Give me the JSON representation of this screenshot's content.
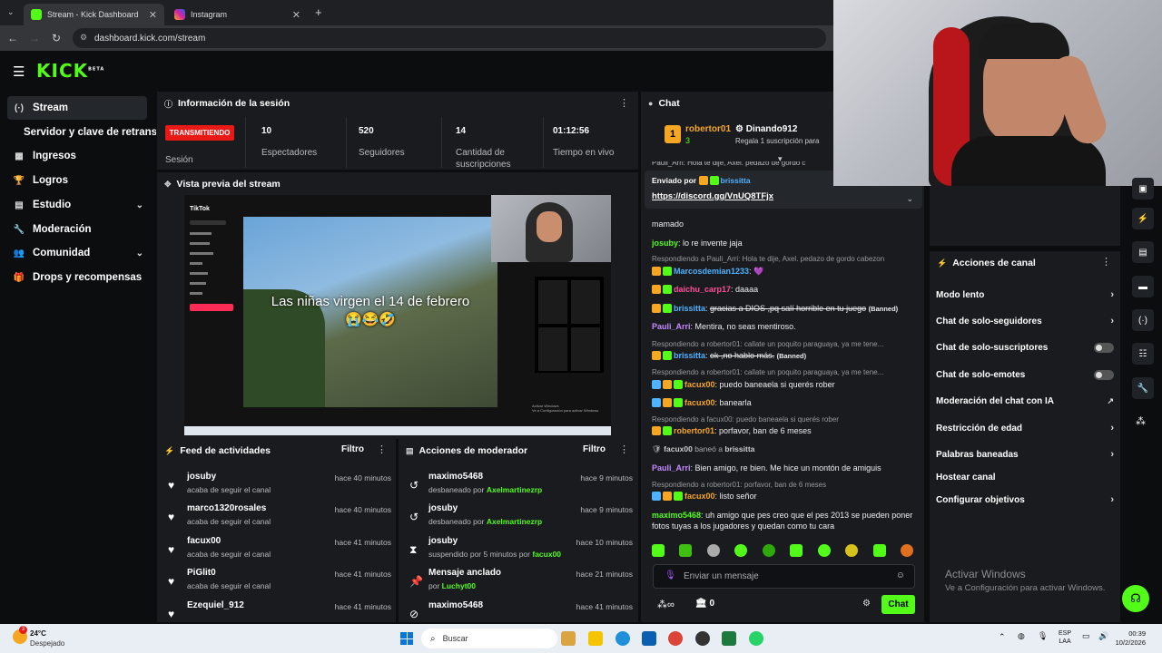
{
  "browser": {
    "tabs": [
      {
        "title": "Stream - Kick Dashboard"
      },
      {
        "title": "Instagram"
      }
    ],
    "url": "dashboard.kick.com/stream"
  },
  "logo": {
    "text": "KICK",
    "beta": "BETA"
  },
  "sidebar": {
    "items": [
      {
        "label": "Stream"
      },
      {
        "label": "Servidor y clave de retransm"
      },
      {
        "label": "Ingresos"
      },
      {
        "label": "Logros"
      },
      {
        "label": "Estudio"
      },
      {
        "label": "Moderación"
      },
      {
        "label": "Comunidad"
      },
      {
        "label": "Drops y recompensas"
      }
    ]
  },
  "session": {
    "title": "Información de la sesión",
    "live_badge": "TRANSMITIENDO",
    "live_label": "Sesión",
    "stats": [
      {
        "value": "10",
        "label": "Espectadores"
      },
      {
        "value": "520",
        "label": "Seguidores"
      },
      {
        "value": "14",
        "label": "Cantidad de suscripciones"
      },
      {
        "value": "01:12:56",
        "label": "Tiempo en vivo"
      }
    ]
  },
  "preview": {
    "title": "Vista previa del stream",
    "caption": "Las niñas virgen el 14 de febrero 😭😂🤣",
    "app_name": "TikTok",
    "watermark_1": "Activar Windows",
    "watermark_2": "Ve a Configuración para activar Windows."
  },
  "feed": {
    "title": "Feed de actividades",
    "filter": "Filtro",
    "items": [
      {
        "user": "josuby",
        "action": "acaba de seguir el canal",
        "time": "hace 40 minutos"
      },
      {
        "user": "marco1320rosales",
        "action": "acaba de seguir el canal",
        "time": "hace 40 minutos"
      },
      {
        "user": "facux00",
        "action": "acaba de seguir el canal",
        "time": "hace 41 minutos"
      },
      {
        "user": "PiGlit0",
        "action": "acaba de seguir el canal",
        "time": "hace 41 minutos"
      },
      {
        "user": "Ezequiel_912",
        "action": "",
        "time": "hace 41 minutos"
      }
    ]
  },
  "modactions": {
    "title": "Acciones de moderador",
    "filter": "Filtro",
    "items": [
      {
        "user": "maximo5468",
        "action": "desbaneado por",
        "by": "Axelmartinezrp",
        "time": "hace 9 minutos"
      },
      {
        "user": "josuby",
        "action": "desbaneado por",
        "by": "Axelmartinezrp",
        "time": "hace 9 minutos"
      },
      {
        "user": "josuby",
        "action": "suspendido por 5 minutos por",
        "by": "facux00",
        "time": "hace 10 minutos"
      },
      {
        "user": "Mensaje anclado",
        "action": "por",
        "by": "Luchyt00",
        "time": "hace 21 minutos"
      },
      {
        "user": "maximo5468",
        "action": "",
        "by": "",
        "time": "hace 41 minutos"
      }
    ]
  },
  "chat": {
    "title": "Chat",
    "top_gifter": {
      "name": "robertor01",
      "rank": "1",
      "count": "3"
    },
    "gifter2": {
      "name": "Dinando912",
      "note": "Regala 1 suscripción para"
    },
    "pinned_by_label": "Enviado por",
    "pinned_by": "brissitta",
    "pinned_link": "https://discord.gg/VnUQ8TFjx",
    "truncated_top": "Pauli_Arri: Hola te dije, Axel. pedazo de gordo c",
    "messages": [
      {
        "reply": "",
        "user": "",
        "text": "mamado"
      },
      {
        "reply": "",
        "user": "josuby",
        "text": "lo re invente jaja"
      },
      {
        "reply": "Respondiendo a Pauli_Arri: Hola te dije, Axel. pedazo de gordo cabezon",
        "user": "Marcosdemian1233",
        "text": "💜"
      },
      {
        "reply": "",
        "user": "daichu_carp17",
        "text": "daaaa"
      },
      {
        "reply": "",
        "user": "brissitta",
        "text": "gracias a DIOS ,pq salí horrible en tu juego",
        "tag": "(Banned)"
      },
      {
        "reply": "",
        "user": "Pauli_Arri",
        "text": "Mentira, no seas mentiroso."
      },
      {
        "reply": "Respondiendo a robertor01: callate un poquito paraguaya, ya me tene...",
        "user": "brissitta",
        "text": "ok ,no hablo más.",
        "tag": "(Banned)"
      },
      {
        "reply": "Respondiendo a robertor01: callate un poquito paraguaya, ya me tene...",
        "user": "facux00",
        "text": "puedo baneaela si querés rober"
      },
      {
        "reply": "",
        "user": "facux00",
        "text": "banearla"
      },
      {
        "reply": "Respondiendo a facux00: puedo baneaela si querés rober",
        "user": "robertor01",
        "text": "porfavor, ban de 6 meses"
      },
      {
        "reply": "",
        "user": "facux00",
        "text": "baneó a",
        "target": "brissitta"
      },
      {
        "reply": "",
        "user": "Pauli_Arri",
        "text": "Bien amigo, re bien. Me hice un montón de amiguis"
      },
      {
        "reply": "Respondiendo a robertor01: porfavor, ban de 6 meses",
        "user": "facux00",
        "text": "listo señor"
      },
      {
        "reply": "",
        "user": "maximo5468",
        "text": "uh amigo que pes creo que el pes 2013 se pueden poner fotos tuyas a los jugadores y quedan como tu cara"
      }
    ],
    "input_placeholder": "Enviar un mensaje",
    "points": "0",
    "send": "Chat"
  },
  "actions": {
    "title": "Acciones de canal",
    "items": [
      {
        "label": "Modo lento",
        "kind": "arrow"
      },
      {
        "label": "Chat de solo-seguidores",
        "kind": "arrow"
      },
      {
        "label": "Chat de solo-suscriptores",
        "kind": "toggle"
      },
      {
        "label": "Chat de solo-emotes",
        "kind": "toggle"
      },
      {
        "label": "Moderación del chat con IA",
        "kind": "external"
      },
      {
        "label": "Restricción de edad",
        "kind": "arrow"
      },
      {
        "label": "Palabras baneadas",
        "kind": "arrow"
      },
      {
        "label": "Hostear canal",
        "kind": "none"
      },
      {
        "label": "Configurar objetivos",
        "kind": "arrow"
      }
    ]
  },
  "watermark": {
    "line1": "Activar Windows",
    "line2": "Ve a Configuración para activar Windows."
  },
  "taskbar": {
    "weather_temp": "24°C",
    "weather_desc": "Despejado",
    "weather_badge": "3",
    "search": "Buscar",
    "lang1": "ESP",
    "lang2": "LAA",
    "time": "00:39",
    "date": "10/2/2026"
  },
  "colors": {
    "accent": "#53fc18",
    "live": "#e91916",
    "panel": "#191b1f"
  }
}
